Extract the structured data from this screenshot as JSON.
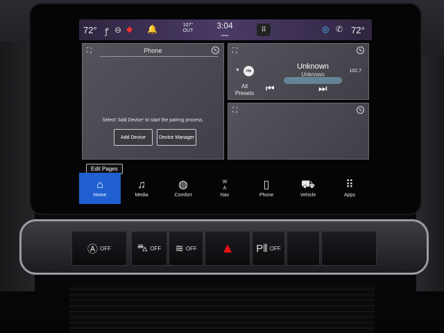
{
  "status": {
    "temp_left": "72°",
    "temp_right": "72°",
    "outside_temp": "107°",
    "outside_label": "OUT",
    "time": "3:04"
  },
  "phone": {
    "title": "Phone",
    "message": "Select 'Add Device' to start the pairing process.",
    "add_device": "Add Device",
    "device_manager": "Device Manager"
  },
  "media": {
    "band": "FM",
    "station": "Unknown",
    "station_sub": "Unknown",
    "frequency": "102.7",
    "presets_line1": "All",
    "presets_line2": "Presets"
  },
  "edit_pages": "Edit Pages",
  "dock": [
    {
      "label": "Home",
      "icon": "home-icon",
      "glyph": "⌂"
    },
    {
      "label": "Media",
      "icon": "music-note-icon",
      "glyph": "♫"
    },
    {
      "label": "Comfort",
      "icon": "comfort-icon",
      "glyph": "◍"
    },
    {
      "label": "Nav",
      "icon": "compass-icon",
      "glyph": "W",
      "glyph2": "A"
    },
    {
      "label": "Phone",
      "icon": "phone-icon",
      "glyph": "▯"
    },
    {
      "label": "Vehicle",
      "icon": "car-icon",
      "glyph": "⛟"
    },
    {
      "label": "Apps",
      "icon": "apps-grid-icon",
      "glyph": "⠿"
    }
  ],
  "hardware": {
    "auto_off": "OFF",
    "descent_off": "OFF",
    "traction_off": "OFF",
    "park_assist_off": "OFF"
  },
  "colors": {
    "active_tab": "#1f5fd0",
    "status_bar": "#4a3b66",
    "hazard": "#e11111"
  }
}
